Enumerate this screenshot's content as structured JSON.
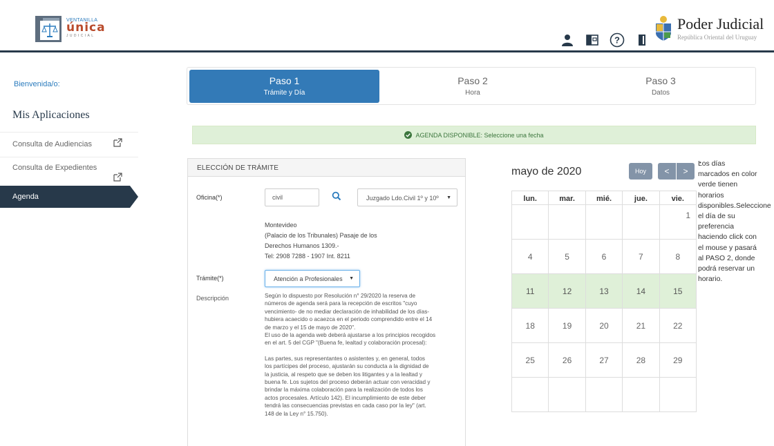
{
  "header": {
    "logo": {
      "top": "VENTANILLA",
      "main": "única",
      "sub": "JUDICIAL"
    },
    "icons": [
      "user-icon",
      "inbox-icon",
      "help-icon",
      "exit-door-icon"
    ],
    "brand": {
      "title": "Poder Judicial",
      "subtitle": "República Oriental del Uruguay"
    },
    "colors": {
      "dark": "#27394a",
      "accent": "#337ab7"
    }
  },
  "sidebar": {
    "welcome": "Bienvenida/o:",
    "title": "Mis Aplicaciones",
    "items": [
      {
        "label": "Consulta de Audiencias"
      },
      {
        "label": "Consulta de Expedientes"
      },
      {
        "label": "Agenda"
      }
    ]
  },
  "steps": [
    {
      "title": "Paso 1",
      "subtitle": "Trámite y Día"
    },
    {
      "title": "Paso 2",
      "subtitle": "Hora"
    },
    {
      "title": "Paso 3",
      "subtitle": "Datos"
    }
  ],
  "alert": {
    "strong": "AGENDA DISPONIBLE",
    "text": ": Seleccione una fecha"
  },
  "tramite": {
    "heading": "ELECCIÓN DE TRÁMITE",
    "oficina_label": "Oficina(*)",
    "oficina_value": "civil",
    "oficina_select": "Juzgado Ldo.Civil 1º y 10º",
    "address": [
      "Montevideo",
      "(Palacio de los Tribunales) Pasaje de los",
      "Derechos Humanos 1309.-",
      "Tel: 2908 7288 - 1907 Int. 8211"
    ],
    "tramite_label": "Trámite(*)",
    "tramite_select": "Atención a Profesionales",
    "desc_label": "Descripción",
    "desc_lines_1": [
      "Según lo dispuesto por Resolución n° 29/2020 la reserva de",
      "números de agenda será para la recepción de escritos \"cuyo",
      "vencimiento- de no mediar declaración de inhabilidad de los días-",
      "hubiera acaecido o acaezca en el periodo comprendido entre el 14",
      "de marzo y el 15 de mayo de 2020\".",
      "El uso de la agenda web deberá ajustarse a los principios recogidos",
      "en el art. 5 del CGP \"(Buena fe, lealtad y colaboración procesal):"
    ],
    "desc_lines_2": [
      "Las partes, sus representantes o asistentes y, en general, todos",
      "los partícipes del proceso, ajustarán su conducta a la dignidad de",
      "la justicia, al respeto que se deben los litigantes y a la lealtad y",
      "buena fe.  Los sujetos del proceso deberán actuar con veracidad y",
      "brindar la máxima colaboración para la realización de todos los",
      "actos procesales. Artículo 142).  El incumplimiento de este deber",
      "tendrá las consecuencias previstas en cada caso por la ley\" (art.",
      "148 de la Ley n° 15.750)."
    ]
  },
  "calendar": {
    "title": "mayo de 2020",
    "today_label": "Hoy",
    "prev_label": "<",
    "next_label": ">",
    "weekdays": [
      "lun.",
      "mar.",
      "mié.",
      "jue.",
      "vie."
    ],
    "weeks": [
      [
        "",
        "",
        "",
        "",
        "1"
      ],
      [
        "4",
        "5",
        "6",
        "7",
        "8"
      ],
      [
        "11",
        "12",
        "13",
        "14",
        "15"
      ],
      [
        "18",
        "19",
        "20",
        "21",
        "22"
      ],
      [
        "25",
        "26",
        "27",
        "28",
        "29"
      ],
      [
        "",
        "",
        "",
        "",
        ""
      ]
    ],
    "available_days": [
      "11",
      "12",
      "13",
      "14",
      "15"
    ],
    "available_color": "#dff0d8"
  },
  "legend": {
    "lines": [
      "Los días",
      "marcados en color",
      "verde tienen",
      "horarios",
      "disponibles.Seleccione",
      "el día de su",
      "preferencia",
      "haciendo click con",
      "el mouse y pasará",
      "al PASO 2, donde",
      "podrá reservar un",
      "horario."
    ]
  }
}
